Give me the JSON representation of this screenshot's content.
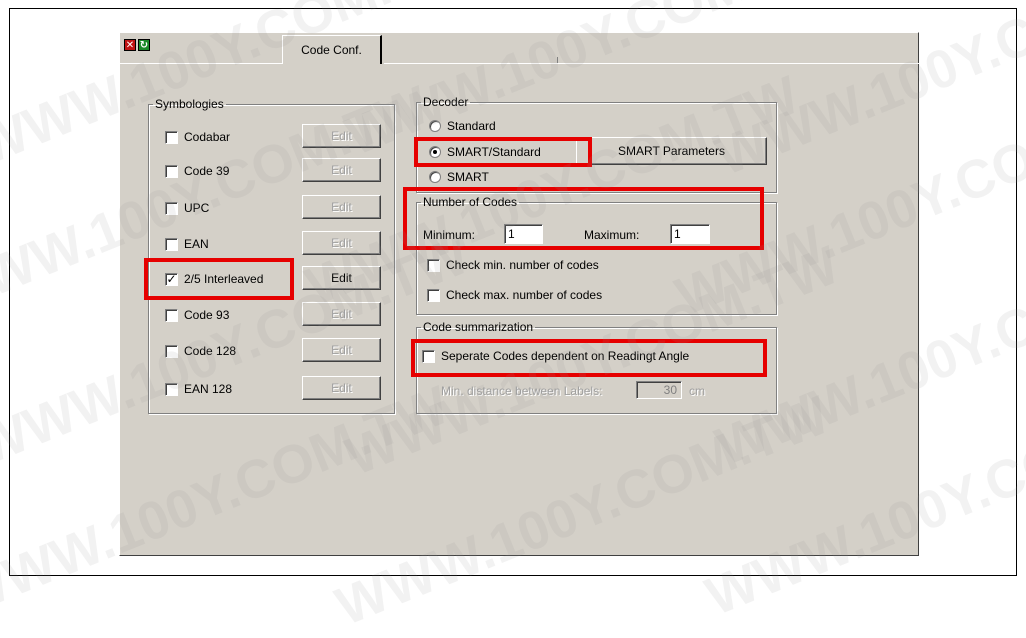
{
  "watermark": "WWW.100Y.COM.TW",
  "tab": {
    "label": "Code Conf."
  },
  "symbologies": {
    "title": "Symbologies",
    "items": [
      {
        "label": "Codabar",
        "checked": false,
        "edit_label": "Edit",
        "edit_enabled": false
      },
      {
        "label": "Code 39",
        "checked": false,
        "edit_label": "Edit",
        "edit_enabled": false
      },
      {
        "label": "UPC",
        "checked": false,
        "edit_label": "Edit",
        "edit_enabled": false
      },
      {
        "label": "EAN",
        "checked": false,
        "edit_label": "Edit",
        "edit_enabled": false
      },
      {
        "label": "2/5 Interleaved",
        "checked": true,
        "edit_label": "Edit",
        "edit_enabled": true
      },
      {
        "label": "Code 93",
        "checked": false,
        "edit_label": "Edit",
        "edit_enabled": false
      },
      {
        "label": "Code 128",
        "checked": false,
        "edit_label": "Edit",
        "edit_enabled": false
      },
      {
        "label": "EAN 128",
        "checked": false,
        "edit_label": "Edit",
        "edit_enabled": false
      }
    ]
  },
  "decoder": {
    "title": "Decoder",
    "options": [
      "Standard",
      "SMART/Standard",
      "SMART"
    ],
    "selected": "SMART/Standard",
    "smart_params_label": "SMART Parameters"
  },
  "number_of_codes": {
    "title": "Number of Codes",
    "min_label": "Minimum:",
    "min_value": "1",
    "max_label": "Maximum:",
    "max_value": "1",
    "check_min_label": "Check min. number of codes",
    "check_max_label": "Check max. number of codes"
  },
  "code_summarization": {
    "title": "Code summarization",
    "separate_label": "Seperate Codes dependent on Readingt Angle",
    "min_distance_label": "Min. distance between Labels:",
    "min_distance_value": "30",
    "unit": "cm"
  },
  "colors": {
    "highlight": "#e60000",
    "dialog_bg": "#d4d0c8"
  }
}
